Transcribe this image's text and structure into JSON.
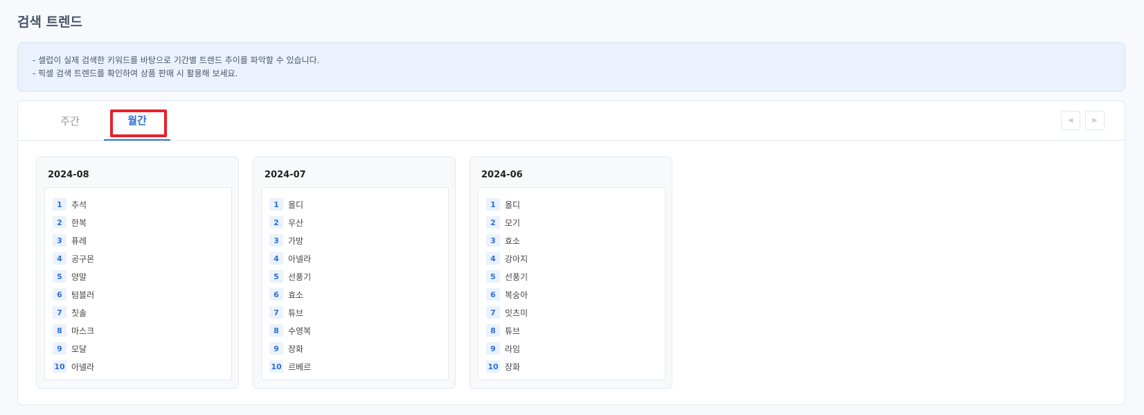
{
  "page": {
    "title": "검색 트렌드"
  },
  "info": {
    "lines": [
      "-  셀럽이 실제 검색한 키워드를 바탕으로 기간별 트렌드 추이를 파악할 수 있습니다.",
      "-  픽셀 검색 트렌드를 확인하여 상품 판매 시 활용해 보세요."
    ]
  },
  "tabs": [
    {
      "label": "주간",
      "active": false
    },
    {
      "label": "월간",
      "active": true
    }
  ],
  "nav": {
    "prev_icon": "triangle-left-icon",
    "next_icon": "triangle-right-icon",
    "prev_glyph": "◀",
    "next_glyph": "▶"
  },
  "colors": {
    "accent": "#2f6ed6",
    "highlight": "#e8202b"
  },
  "months": [
    {
      "period": "2024-08",
      "items": [
        {
          "rank": "1",
          "keyword": "추석"
        },
        {
          "rank": "2",
          "keyword": "한복"
        },
        {
          "rank": "3",
          "keyword": "퓨레"
        },
        {
          "rank": "4",
          "keyword": "공구몬"
        },
        {
          "rank": "5",
          "keyword": "양말"
        },
        {
          "rank": "6",
          "keyword": "텀블러"
        },
        {
          "rank": "7",
          "keyword": "칫솔"
        },
        {
          "rank": "8",
          "keyword": "마스크"
        },
        {
          "rank": "9",
          "keyword": "모달"
        },
        {
          "rank": "10",
          "keyword": "아넬라"
        }
      ]
    },
    {
      "period": "2024-07",
      "items": [
        {
          "rank": "1",
          "keyword": "올디"
        },
        {
          "rank": "2",
          "keyword": "우산"
        },
        {
          "rank": "3",
          "keyword": "가방"
        },
        {
          "rank": "4",
          "keyword": "아넬라"
        },
        {
          "rank": "5",
          "keyword": "선풍기"
        },
        {
          "rank": "6",
          "keyword": "효소"
        },
        {
          "rank": "7",
          "keyword": "튜브"
        },
        {
          "rank": "8",
          "keyword": "수영복"
        },
        {
          "rank": "9",
          "keyword": "장화"
        },
        {
          "rank": "10",
          "keyword": "르베르"
        }
      ]
    },
    {
      "period": "2024-06",
      "items": [
        {
          "rank": "1",
          "keyword": "올디"
        },
        {
          "rank": "2",
          "keyword": "모기"
        },
        {
          "rank": "3",
          "keyword": "효소"
        },
        {
          "rank": "4",
          "keyword": "강아지"
        },
        {
          "rank": "5",
          "keyword": "선풍기"
        },
        {
          "rank": "6",
          "keyword": "복숭아"
        },
        {
          "rank": "7",
          "keyword": "잇츠미"
        },
        {
          "rank": "8",
          "keyword": "튜브"
        },
        {
          "rank": "9",
          "keyword": "라임"
        },
        {
          "rank": "10",
          "keyword": "장화"
        }
      ]
    }
  ]
}
